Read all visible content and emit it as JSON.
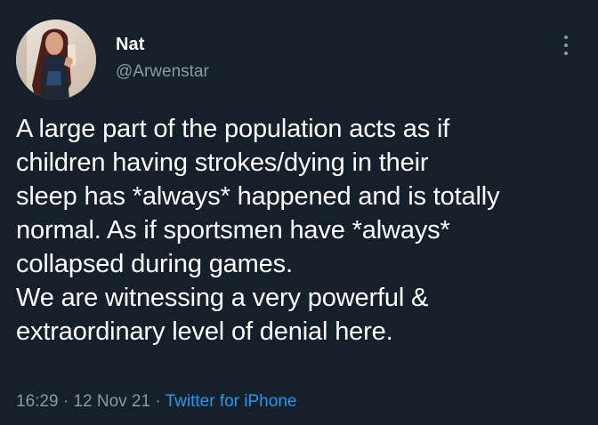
{
  "user": {
    "name": "Nat",
    "handle": "@Arwenstar"
  },
  "tweet": {
    "lines": [
      "A large part of the population acts as if",
      "children having strokes/dying in their",
      "sleep has *always* happened and is totally",
      "normal. As if sportsmen have *always*",
      "collapsed during games.",
      "We are witnessing a very powerful &",
      "extraordinary level of denial here."
    ],
    "time": "16:29",
    "separator": "·",
    "date": "12 Nov 21",
    "source": "Twitter for iPhone"
  },
  "icons": {
    "more": "more-vertical-icon"
  },
  "colors": {
    "background": "#15202b",
    "text": "#ffffff",
    "secondary": "#8b98a5",
    "link": "#1d9bf0"
  }
}
